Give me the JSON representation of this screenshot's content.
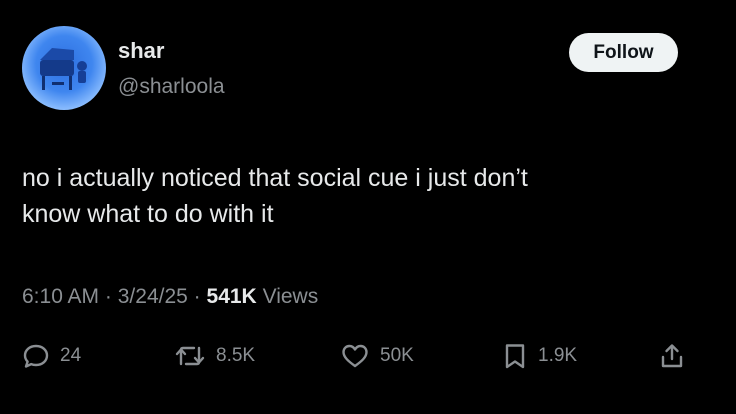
{
  "author": {
    "display_name": "shar",
    "handle": "@sharloola",
    "avatar_icon": "piano-avatar"
  },
  "follow_button": {
    "label": "Follow"
  },
  "tweet": {
    "text": "no i actually noticed that social cue i just don’t\nknow what to do with it"
  },
  "meta": {
    "time": "6:10 AM",
    "separator": "·",
    "date": "3/24/25",
    "views_count": "541K",
    "views_label": "Views"
  },
  "actions": {
    "reply": {
      "icon": "reply-icon",
      "count": "24"
    },
    "repost": {
      "icon": "repost-icon",
      "count": "8.5K"
    },
    "like": {
      "icon": "heart-icon",
      "count": "50K"
    },
    "bookmark": {
      "icon": "bookmark-icon",
      "count": "1.9K"
    },
    "share": {
      "icon": "share-icon"
    }
  },
  "colors": {
    "background": "#000000",
    "primary_text": "#e7e9ea",
    "secondary_text": "#8b8f93",
    "follow_bg": "#eff3f4",
    "avatar_blue": "#3f86ef"
  }
}
